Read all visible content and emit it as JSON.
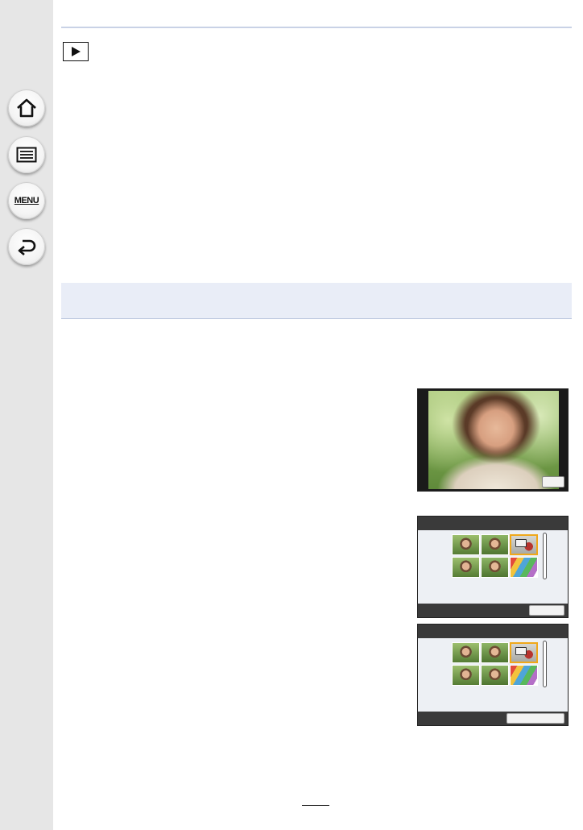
{
  "sidebar": {
    "items": [
      {
        "name": "home",
        "icon": "home-icon"
      },
      {
        "name": "contents",
        "icon": "list-icon"
      },
      {
        "name": "menu",
        "icon": "menu-icon",
        "label": "MENU"
      },
      {
        "name": "back",
        "icon": "back-arrow-icon"
      }
    ]
  },
  "header": {
    "mode_icon": "play-icon"
  },
  "figures": {
    "photo": {
      "icon": "portrait-photo"
    },
    "grid_a": {
      "selected_thumb": 3,
      "mark_icon": "edit-mark-icon"
    },
    "grid_b": {
      "selected_thumb": 3,
      "mark_icon": "lock-mark-icon"
    }
  },
  "colors": {
    "sidebar": "#e6e6e6",
    "rule": "#c9d2e6",
    "band": "#e9edf7",
    "selection": "#f0a81a"
  }
}
